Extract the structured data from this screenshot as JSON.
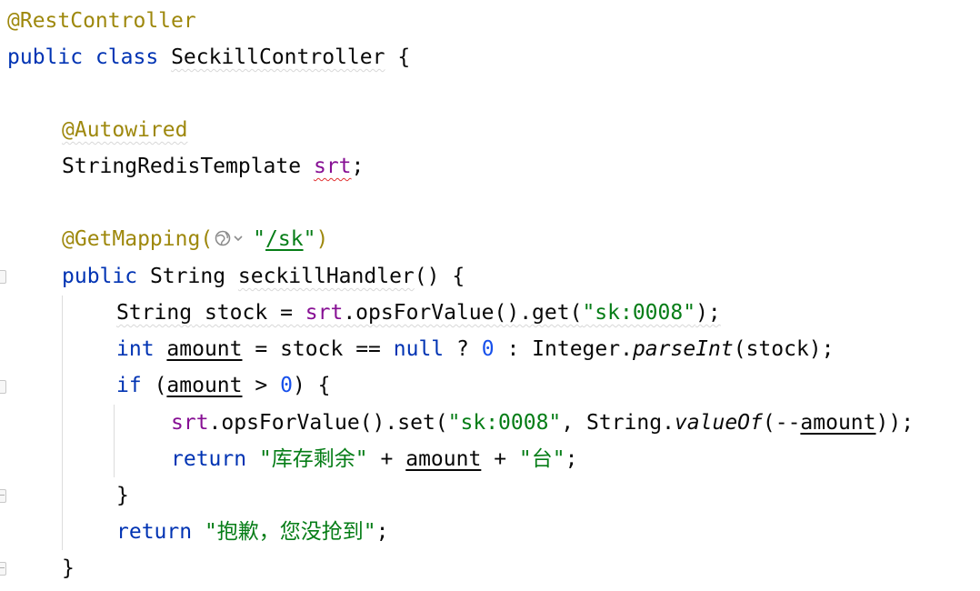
{
  "code": {
    "annotation_restcontroller": "@RestController",
    "kw_public": "public",
    "kw_class": "class",
    "class_name": "SeckillController",
    "brace_open": "{",
    "brace_close": "}",
    "annotation_autowired": "@Autowired",
    "type_string_redis_template": "StringRedisTemplate",
    "field_srt": "srt",
    "semicolon": ";",
    "annotation_getmapping": "@GetMapping(",
    "mapping_quote_open": "\"",
    "mapping_path": "/sk",
    "mapping_quote_close": "\"",
    "paren_close": ")",
    "type_string": "String",
    "method_name": "seckillHandler",
    "method_params": "() {",
    "var_stock": "stock",
    "assign": "=",
    "ops_get": ".opsForValue().get(",
    "str_key": "\"sk:0008\"",
    "call_end": ");",
    "kw_int": "int",
    "var_amount": "amount",
    "op_eq": "==",
    "kw_null": "null",
    "op_ternary": "?",
    "num_zero": "0",
    "op_colon": ":",
    "integer_class": "Integer.",
    "method_parseint": "parseInt",
    "arg_stock": "(stock);",
    "kw_if": "if",
    "paren_open": "(",
    "op_gt": ">",
    "if_end": ") {",
    "ops_set": ".opsForValue().set(",
    "comma": ",",
    "string_dot": "String.",
    "method_valueof": "valueOf",
    "decrement": "(--",
    "set_end": "));",
    "kw_return": "return",
    "str_stock_left": "\"库存剩余\"",
    "op_plus": "+",
    "str_unit": "\"台\"",
    "str_sorry": "\"抱歉，您没抢到\""
  },
  "icons": {
    "inlay_hint": "globe-dropdown-icon",
    "fold_marker": "fold-marker-icon"
  },
  "colors": {
    "keyword": "#0033b3",
    "annotation": "#9e880d",
    "string": "#067d17",
    "number": "#1750eb",
    "field": "#871094",
    "text": "#080808"
  }
}
